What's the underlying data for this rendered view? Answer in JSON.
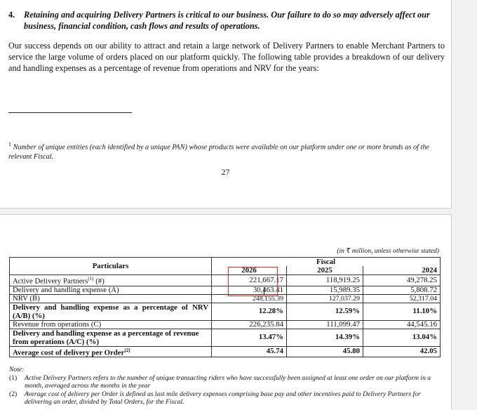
{
  "risk_factor": {
    "number": "4.",
    "heading": "Retaining and acquiring Delivery Partners is critical to our business. Our failure to do so may adversely affect our business, financial condition, cash flows and results of operations."
  },
  "paragraph": "Our success depends on our ability to attract and retain a large network of Delivery Partners to enable Merchant Partners to service the large volume of orders placed on our platform quickly. The following table provides a breakdown of our delivery and handling expenses as a percentage of revenue from operations and NRV for the years:",
  "footnote": {
    "marker": "1",
    "text": "Number of unique entities (each identified by a unique PAN) whose products were available on our platform under one or more brands as of the relevant Fiscal."
  },
  "page_number": "27",
  "table": {
    "unit_note": "(in ₹ million, unless otherwise stated)",
    "header_particulars": "Particulars",
    "header_group": "Fiscal",
    "years": [
      "2026",
      "2025",
      "2024"
    ],
    "rows": [
      {
        "label": "Active Delivery Partners",
        "sup": "(1)",
        "suffix": " (#)",
        "values": [
          "221,667.17",
          "118,919.25",
          "49,278.25"
        ],
        "bold": false
      },
      {
        "label": "Delivery and handling expense (A)",
        "values": [
          "30,463.41",
          "15,989.35",
          "5,808.72"
        ],
        "bold": false
      },
      {
        "label": "NRV (B)",
        "values": [
          "248,155.39",
          "127,037.29",
          "52,317.04"
        ],
        "bold": false
      },
      {
        "label": "Delivery and handling expense as a percentage of NRV (A/B) (%)",
        "values": [
          "12.28%",
          "12.59%",
          "11.10%"
        ],
        "bold": true
      },
      {
        "label": "Revenue from operations (C)",
        "values": [
          "226,235.84",
          "111,099.47",
          "44,545.16"
        ],
        "bold": false
      },
      {
        "label": "Delivery and handling expense as a percentage of revenue from operations (A/C) (%)",
        "values": [
          "13.47%",
          "14.39%",
          "13.04%"
        ],
        "bold": true
      },
      {
        "label": "Average cost of delivery per Order",
        "sup": "(2)",
        "suffix": "",
        "values": [
          "45.74",
          "45.80",
          "42.05"
        ],
        "bold": true
      }
    ]
  },
  "notes": {
    "heading": "Note:",
    "items": [
      {
        "key": "(1)",
        "text": "Active Delivery Partners refers to the number of unique transacting riders who have successfully been assigned at least one order on our platform in a month, averaged across the months in the year"
      },
      {
        "key": "(2)",
        "text": "Average cost of delivery per Order is defined as last mile delivery expenses comprising base pay and other incentives paid to Delivery Partners for delivering an order, divided by Total Orders, for the Fiscal."
      }
    ]
  },
  "colors": {
    "highlight_box": "#e8261c",
    "page_background": "#ffffff",
    "viewer_background": "#f1f1f1"
  }
}
